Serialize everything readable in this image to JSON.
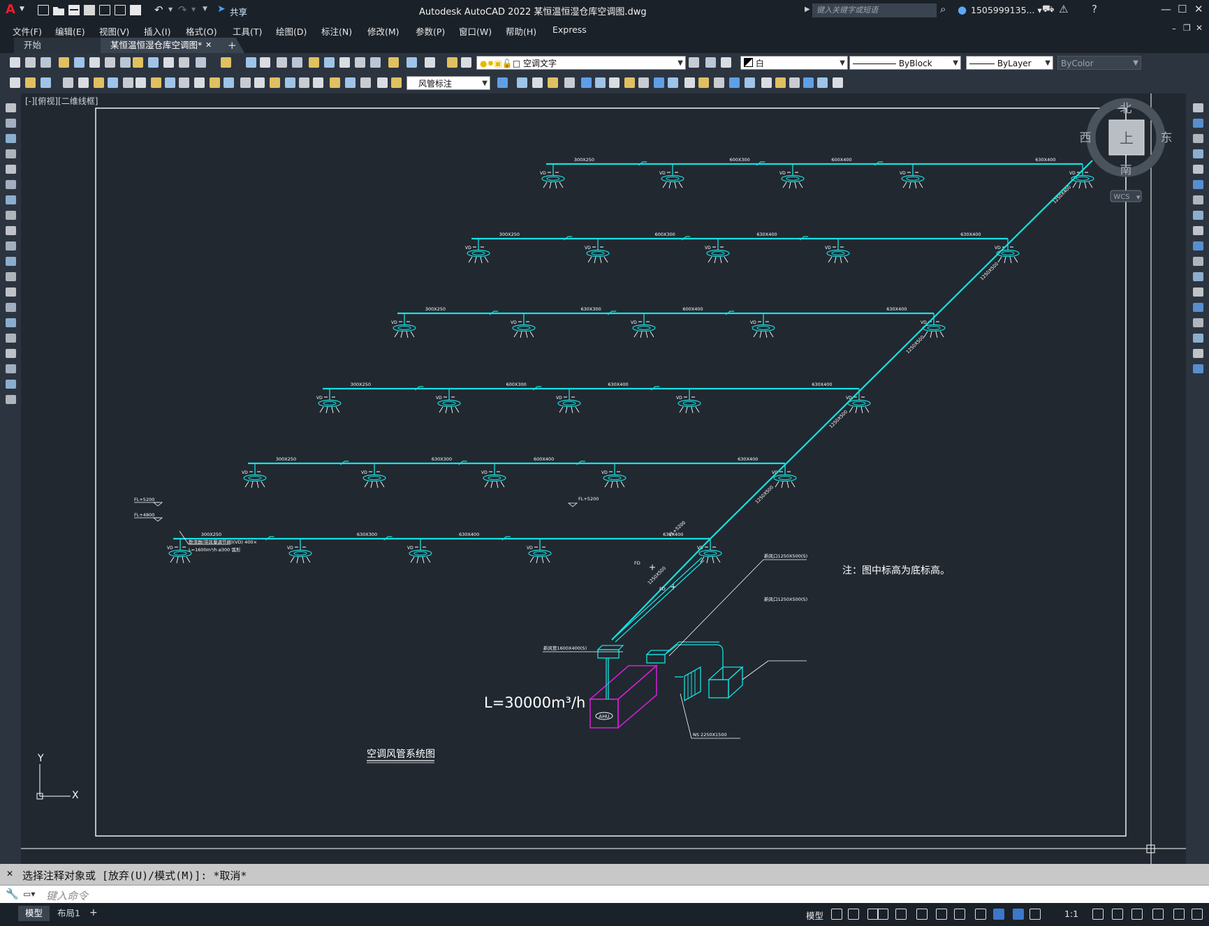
{
  "app": {
    "title": "Autodesk AutoCAD 2022    某恒温恒湿仓库空调图.dwg",
    "logo_letter": "A",
    "share_label": "共享",
    "search_placeholder": "键入关键字或短语",
    "user": "1505999135... ▾"
  },
  "menu": {
    "items": [
      "文件(F)",
      "编辑(E)",
      "视图(V)",
      "插入(I)",
      "格式(O)",
      "工具(T)",
      "绘图(D)",
      "标注(N)",
      "修改(M)",
      "参数(P)",
      "窗口(W)",
      "帮助(H)",
      "Express"
    ]
  },
  "tabs": {
    "start": "开始",
    "active": "某恒温恒湿仓库空调图*",
    "close": "✕",
    "add": "+"
  },
  "toolbar": {
    "layer": "空调文字",
    "color": "白",
    "linetype": "ByBlock",
    "lineweight": "ByLayer",
    "plotstyle": "ByColor",
    "dimstyle": "风管标注"
  },
  "viewport": {
    "label": "[-][俯视][二维线框]",
    "viewcube": {
      "north": "北",
      "south": "南",
      "west": "西",
      "east": "东",
      "top": "上",
      "wcs": "WCS"
    }
  },
  "drawing": {
    "colors": {
      "duct": "#18e0e0",
      "equipment": "#d81fd8",
      "text": "#ffffff",
      "frame": "#ffffff",
      "bg": "#212830"
    },
    "rows": [
      {
        "sizes": [
          "300X250",
          "600X300",
          "600X400",
          "630X400"
        ],
        "tag": "VD"
      },
      {
        "sizes": [
          "300X250",
          "600X300",
          "630X400",
          "630X400"
        ],
        "tag": "VD"
      },
      {
        "sizes": [
          "300X250",
          "630X300",
          "600X400",
          "630X400"
        ],
        "tag": "VD"
      },
      {
        "sizes": [
          "300X250",
          "600X300",
          "630X400",
          "630X400"
        ],
        "tag": "VD"
      },
      {
        "sizes": [
          "300X250",
          "630X300",
          "600X400",
          "630X400"
        ],
        "tag": "VD"
      },
      {
        "sizes": [
          "300X250",
          "630X300",
          "630X400",
          "630X400"
        ],
        "tag": "VD"
      }
    ],
    "riser_sizes": [
      "1250X400",
      "1250X500",
      "1250X500",
      "1250X500",
      "1250X500",
      "1250X500"
    ],
    "elev_top": "FL+5200",
    "elev_mid": "FL+5200",
    "elev_left_1": "FL+5200",
    "elev_left_2": "FL+4800",
    "fd": "FD",
    "diffuser_note_1": "散流器(带风量调节阀)(VD) 400×",
    "diffuser_note_2": "L=1600m³/h ø300 弧形",
    "unit_label_1": "新风管1600X400(S)",
    "unit_label_2": "新风口1250X500(S)",
    "unit_label_3": "新风口1250X500(S)",
    "unit_label_4": "NS 2250X1500",
    "equipment_tag": "AHU",
    "airflow": "L=30000m³/h",
    "note": "注：图中标高为底标高。",
    "title": "空调风管系统图",
    "axis_y": "Y",
    "axis_x": "X"
  },
  "command": {
    "history": "选择注释对象或 [放弃(U)/模式(M)]: *取消*",
    "placeholder": "键入命令"
  },
  "status": {
    "tab_model": "模型",
    "tab_layout": "布局1",
    "tab_add": "+",
    "model_label": "模型",
    "scale": "1:1"
  }
}
